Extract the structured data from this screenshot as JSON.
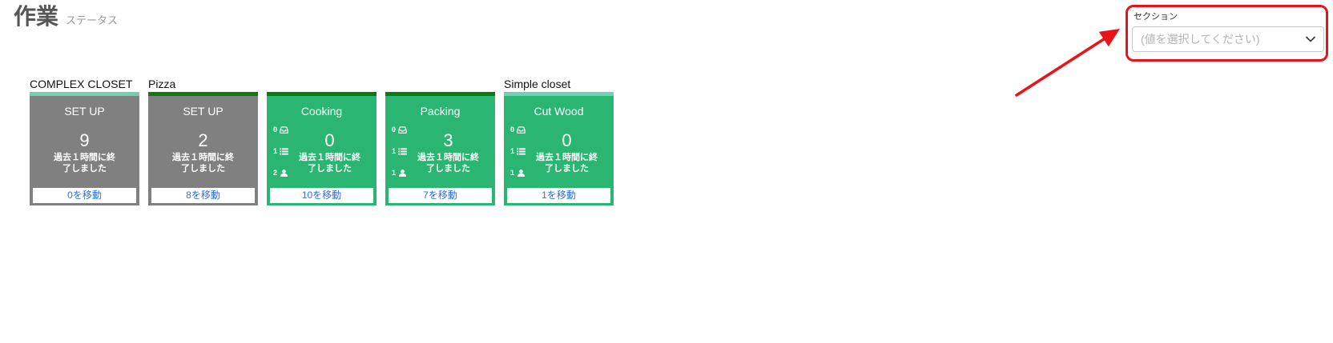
{
  "header": {
    "title": "作業",
    "subtitle": "ステータス"
  },
  "section_filter": {
    "label": "セクション",
    "placeholder": "(値を選択してください)",
    "icon": "chevron-down-icon"
  },
  "annotation": {
    "color": "#e8141a"
  },
  "theme": {
    "action_link": "#2f6fdc"
  },
  "groups": [
    {
      "label": "COMPLEX CLOSET",
      "color": "#70d0b2",
      "cards": [
        {
          "name": "SET UP",
          "count": "9",
          "caption": "過去１時間に終了しました",
          "action": "0を移動",
          "color": "#808080"
        }
      ]
    },
    {
      "label": "Pizza",
      "color": "#0b7b0b",
      "cards": [
        {
          "name": "SET UP",
          "count": "2",
          "caption": "過去１時間に終了しました",
          "action": "8を移動",
          "color": "#808080"
        },
        {
          "name": "Cooking",
          "count": "0",
          "caption": "過去１時間に終了しました",
          "action": "10を移動",
          "color": "#2ab573",
          "stats": [
            {
              "value": "0",
              "icon": "inbox-icon"
            },
            {
              "value": "1",
              "icon": "list-icon"
            },
            {
              "value": "2",
              "icon": "user-icon"
            }
          ]
        },
        {
          "name": "Packing",
          "count": "3",
          "caption": "過去１時間に終了しました",
          "action": "7を移動",
          "color": "#2ab573",
          "stats": [
            {
              "value": "0",
              "icon": "inbox-icon"
            },
            {
              "value": "1",
              "icon": "list-icon"
            },
            {
              "value": "1",
              "icon": "user-icon"
            }
          ]
        }
      ]
    },
    {
      "label": "Simple closet",
      "color": "#70d0b2",
      "cards": [
        {
          "name": "Cut Wood",
          "count": "0",
          "caption": "過去１時間に終了しました",
          "action": "1を移動",
          "color": "#2ab573",
          "stats": [
            {
              "value": "0",
              "icon": "inbox-icon"
            },
            {
              "value": "1",
              "icon": "list-icon"
            },
            {
              "value": "1",
              "icon": "user-icon"
            }
          ]
        }
      ]
    }
  ]
}
